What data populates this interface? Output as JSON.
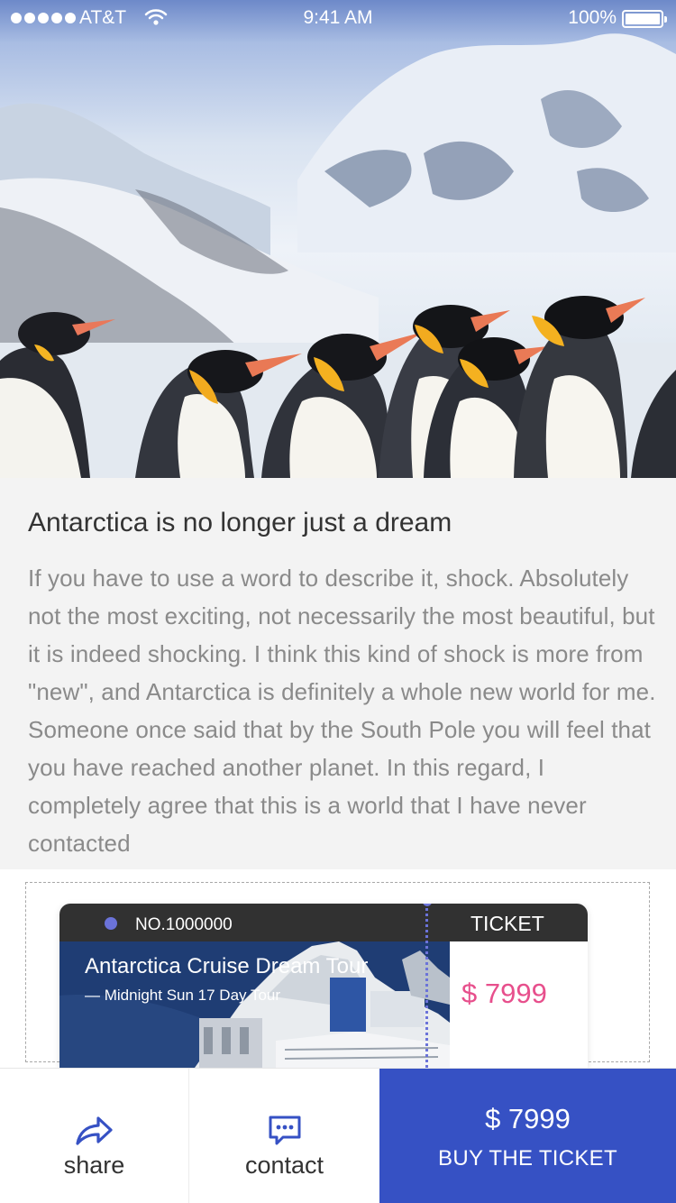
{
  "status_bar": {
    "carrier": "AT&T",
    "time": "9:41 AM",
    "battery": "100%"
  },
  "hero": {
    "icon": "penguins-photo"
  },
  "article": {
    "title": "Antarctica is no longer just a dream",
    "body": "If you have to use a word to describe it, shock. Absolutely not the most exciting, not necessarily the most beautiful, but it is indeed shocking. I think this kind of shock is more from \"new\", and Antarctica is definitely a whole new world for me. Someone once said that by the South Pole you will feel that you have reached another planet. In this regard, I completely agree that this is a world that I have never contacted"
  },
  "ticket": {
    "number": "NO.1000000",
    "label": "TICKET",
    "name": "Antarctica Cruise Dream Tour",
    "subtitle": "— Midnight Sun 17 Day Tour",
    "price": "$ 7999"
  },
  "bottom_bar": {
    "share_label": "share",
    "contact_label": "contact",
    "buy_price": "$ 7999",
    "buy_label": "BUY THE TICKET"
  },
  "colors": {
    "accent": "#3651c4",
    "price": "#e74f8c",
    "ticket_dot": "#6b73d9",
    "ticket_header": "#313131"
  }
}
